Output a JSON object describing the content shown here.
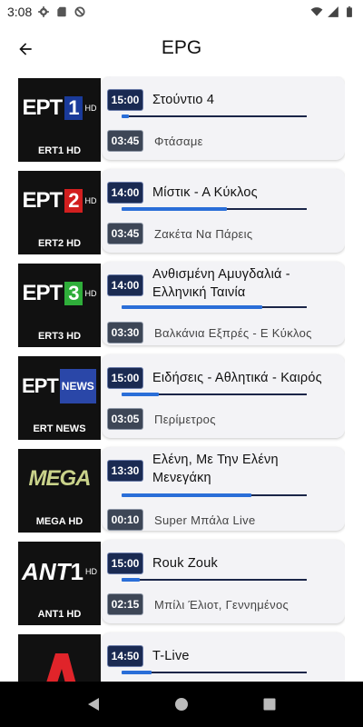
{
  "status_bar": {
    "time": "3:08",
    "left_icons": [
      "gear-icon",
      "sd-card-icon",
      "no-sync-icon"
    ],
    "right_icons": [
      "wifi-icon",
      "signal-icon",
      "battery-icon"
    ]
  },
  "header": {
    "title": "EPG",
    "back_icon": "arrow-left-icon"
  },
  "colors": {
    "now_badge": "#1a2a52",
    "next_badge": "#3d4656",
    "progress": "#2a6ed8",
    "card_bg": "#f3f3f6"
  },
  "channels": [
    {
      "logo_text": "ΕΡΤ",
      "logo_badge": "1",
      "logo_suffix": "HD",
      "name": "ERT1 HD",
      "now_time": "15:00",
      "now_title": "Στούντιο 4",
      "progress": 0.04,
      "next_time": "03:45",
      "next_title": "Φτάσαμε"
    },
    {
      "logo_text": "ΕΡΤ",
      "logo_badge": "2",
      "logo_suffix": "HD",
      "name": "ERT2 HD",
      "now_time": "14:00",
      "now_title": "Μίστικ - Α Κύκλος",
      "progress": 0.57,
      "next_time": "03:45",
      "next_title": "Ζακέτα Να Πάρεις"
    },
    {
      "logo_text": "ΕΡΤ",
      "logo_badge": "3",
      "logo_suffix": "HD",
      "name": "ERT3 HD",
      "now_time": "14:00",
      "now_title": "Ανθισμένη Αμυγδαλιά - Ελληνική Ταινία",
      "progress": 0.76,
      "next_time": "03:30",
      "next_title": "Βαλκάνια Εξπρές   - Ε Κύκλος"
    },
    {
      "logo_text": "ΕΡΤ",
      "logo_badge": "NEWS",
      "logo_suffix": "",
      "name": "ERT NEWS",
      "now_time": "15:00",
      "now_title": "Ειδήσεις - Αθλητικά - Καιρός",
      "progress": 0.2,
      "next_time": "03:05",
      "next_title": "Περίμετρος"
    },
    {
      "logo_text": "MEGA",
      "logo_badge": "",
      "logo_suffix": "",
      "name": "MEGA HD",
      "now_time": "13:30",
      "now_title": "Ελένη, Με Την Ελένη Μενεγάκη",
      "progress": 0.7,
      "next_time": "00:10",
      "next_title": "Super Μπάλα Live"
    },
    {
      "logo_text": "ΑΝΤ",
      "logo_badge": "1",
      "logo_suffix": "HD",
      "name": "ANT1 HD",
      "now_time": "15:00",
      "now_title": "Rouk Zouk",
      "progress": 0.1,
      "next_time": "02:15",
      "next_title": "Μπίλι Έλιοτ, Γεννημένος"
    },
    {
      "logo_text": "",
      "logo_badge": "",
      "logo_suffix": "",
      "name": "",
      "now_time": "14:50",
      "now_title": "T-Live",
      "progress": 0.16,
      "next_time": "",
      "next_title": ""
    }
  ],
  "nav": {
    "back_icon": "triangle-back-icon",
    "home_icon": "circle-home-icon",
    "recents_icon": "square-recents-icon"
  }
}
